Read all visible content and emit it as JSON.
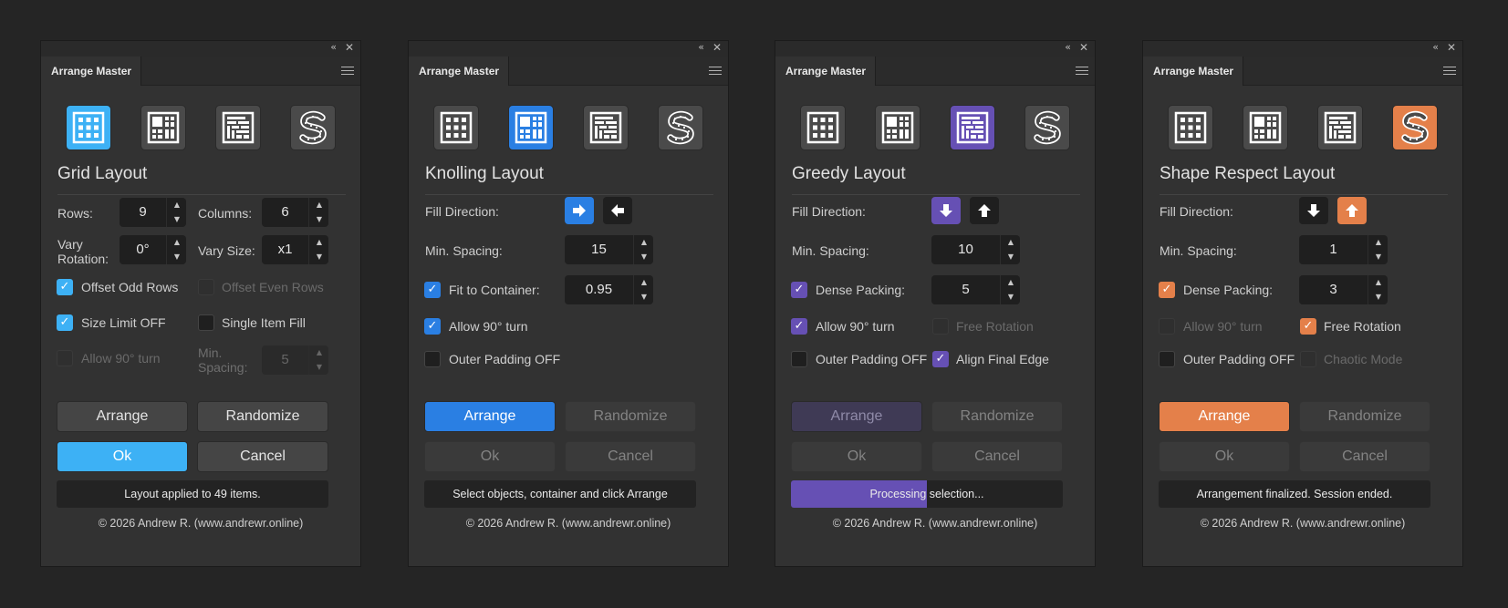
{
  "colors": {
    "grid_accent": "#3db1f5",
    "knolling_accent": "#2a7fe3",
    "greedy_accent": "#6650b4",
    "shape_accent": "#e4804a",
    "panel_bg": "#323232",
    "page_bg": "#252525"
  },
  "icons": [
    "grid-layout-icon",
    "knolling-layout-icon",
    "greedy-layout-icon",
    "shape-respect-layout-icon"
  ],
  "panels": [
    {
      "tab": "Arrange Master",
      "title": "Grid Layout",
      "rows_label": "Rows:",
      "rows_value": "9",
      "columns_label": "Columns:",
      "columns_value": "6",
      "vary_rotation_label_1": "Vary",
      "vary_rotation_label_2": "Rotation:",
      "vary_rotation_value": "0°",
      "vary_size_label": "Vary Size:",
      "vary_size_value": "x1",
      "offset_odd_rows": "Offset Odd Rows",
      "offset_even_rows": "Offset Even Rows",
      "size_limit_off": "Size Limit OFF",
      "single_item_fill": "Single Item Fill",
      "allow_90_turn": "Allow 90° turn",
      "min_spacing_label_1": "Min.",
      "min_spacing_label_2": "Spacing:",
      "min_spacing_value": "5",
      "arrange": "Arrange",
      "randomize": "Randomize",
      "ok": "Ok",
      "cancel": "Cancel",
      "status": "Layout applied to 49 items.",
      "footer": "© 2026 Andrew R. (www.andrewr.online)"
    },
    {
      "tab": "Arrange Master",
      "title": "Knolling Layout",
      "fill_direction_label": "Fill Direction:",
      "min_spacing_label": "Min. Spacing:",
      "min_spacing_value": "15",
      "fit_to_container": "Fit to Container:",
      "fit_value": "0.95",
      "allow_90_turn": "Allow 90° turn",
      "outer_padding_off": "Outer Padding OFF",
      "arrange": "Arrange",
      "randomize": "Randomize",
      "ok": "Ok",
      "cancel": "Cancel",
      "status": "Select objects, container and click Arrange",
      "footer": "© 2026 Andrew R. (www.andrewr.online)"
    },
    {
      "tab": "Arrange Master",
      "title": "Greedy Layout",
      "fill_direction_label": "Fill Direction:",
      "min_spacing_label": "Min. Spacing:",
      "min_spacing_value": "10",
      "dense_packing": "Dense Packing:",
      "dense_value": "5",
      "allow_90_turn": "Allow 90° turn",
      "free_rotation": "Free Rotation",
      "outer_padding_off": "Outer Padding OFF",
      "align_final_edge": "Align Final Edge",
      "arrange": "Arrange",
      "randomize": "Randomize",
      "ok": "Ok",
      "cancel": "Cancel",
      "status": "Processing selection...",
      "progress": 0.5,
      "footer": "© 2026 Andrew R. (www.andrewr.online)"
    },
    {
      "tab": "Arrange Master",
      "title": "Shape Respect Layout",
      "fill_direction_label": "Fill Direction:",
      "min_spacing_label": "Min. Spacing:",
      "min_spacing_value": "1",
      "dense_packing": "Dense Packing:",
      "dense_value": "3",
      "allow_90_turn": "Allow 90° turn",
      "free_rotation": "Free Rotation",
      "outer_padding_off": "Outer Padding OFF",
      "chaotic_mode": "Chaotic Mode",
      "arrange": "Arrange",
      "randomize": "Randomize",
      "ok": "Ok",
      "cancel": "Cancel",
      "status": "Arrangement finalized. Session ended.",
      "footer": "© 2026 Andrew R. (www.andrewr.online)"
    }
  ]
}
